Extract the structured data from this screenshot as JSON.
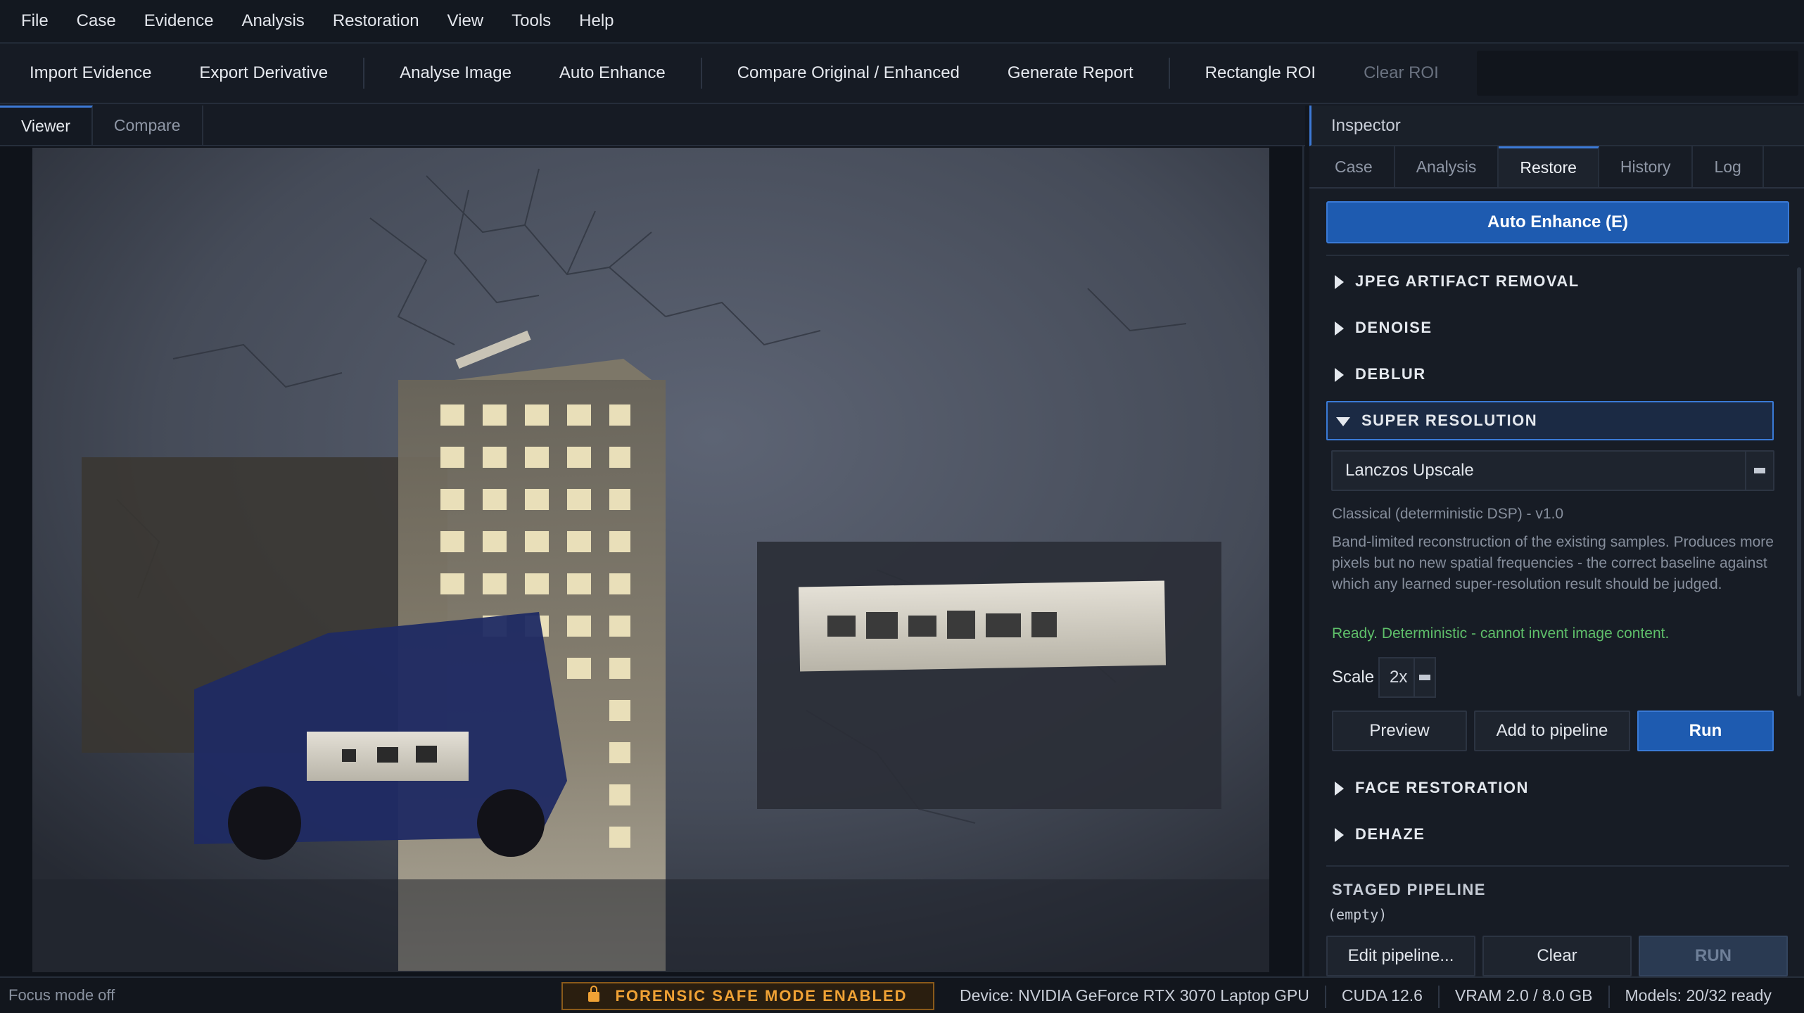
{
  "menu": [
    "File",
    "Case",
    "Evidence",
    "Analysis",
    "Restoration",
    "View",
    "Tools",
    "Help"
  ],
  "toolbar": {
    "import": "Import Evidence",
    "export": "Export Derivative",
    "analyse": "Analyse Image",
    "auto_enhance": "Auto Enhance",
    "compare": "Compare Original / Enhanced",
    "report": "Generate Report",
    "rect_roi": "Rectangle ROI",
    "clear_roi": "Clear ROI"
  },
  "viewer": {
    "tabs": [
      "Viewer",
      "Compare"
    ],
    "active_tab": "Viewer"
  },
  "inspector": {
    "title": "Inspector",
    "tabs": [
      "Case",
      "Analysis",
      "Restore",
      "History",
      "Log"
    ],
    "active_tab": "Restore",
    "auto_enhance_button": "Auto Enhance  (E)",
    "sections": {
      "jpeg": "JPEG ARTIFACT REMOVAL",
      "denoise": "DENOISE",
      "deblur": "DEBLUR",
      "super_resolution": "SUPER RESOLUTION",
      "face": "FACE RESTORATION",
      "dehaze": "DEHAZE"
    },
    "sr": {
      "method": "Lanczos Upscale",
      "meta": "Classical (deterministic DSP)  -  v1.0",
      "description": "Band-limited reconstruction of the existing samples. Produces more pixels but no new spatial frequencies - the correct baseline against which any learned super-resolution result should be judged.",
      "status": "Ready. Deterministic - cannot invent image content.",
      "scale_label": "Scale",
      "scale_value": "2x",
      "preview": "Preview",
      "add": "Add to pipeline",
      "run": "Run"
    },
    "staged": {
      "title": "STAGED PIPELINE",
      "empty": "(empty)",
      "edit": "Edit pipeline...",
      "clear": "Clear",
      "run": "RUN"
    }
  },
  "status": {
    "focus": "Focus mode off",
    "safe_mode": "FORENSIC SAFE MODE ENABLED",
    "device": "Device: NVIDIA GeForce RTX 3070 Laptop GPU",
    "cuda": "CUDA 12.6",
    "vram": "VRAM 2.0 / 8.0 GB",
    "models": "Models: 20/32 ready"
  },
  "colors": {
    "accent": "#1e5bb0",
    "warning": "#f0a235",
    "success": "#5fbf6a"
  }
}
